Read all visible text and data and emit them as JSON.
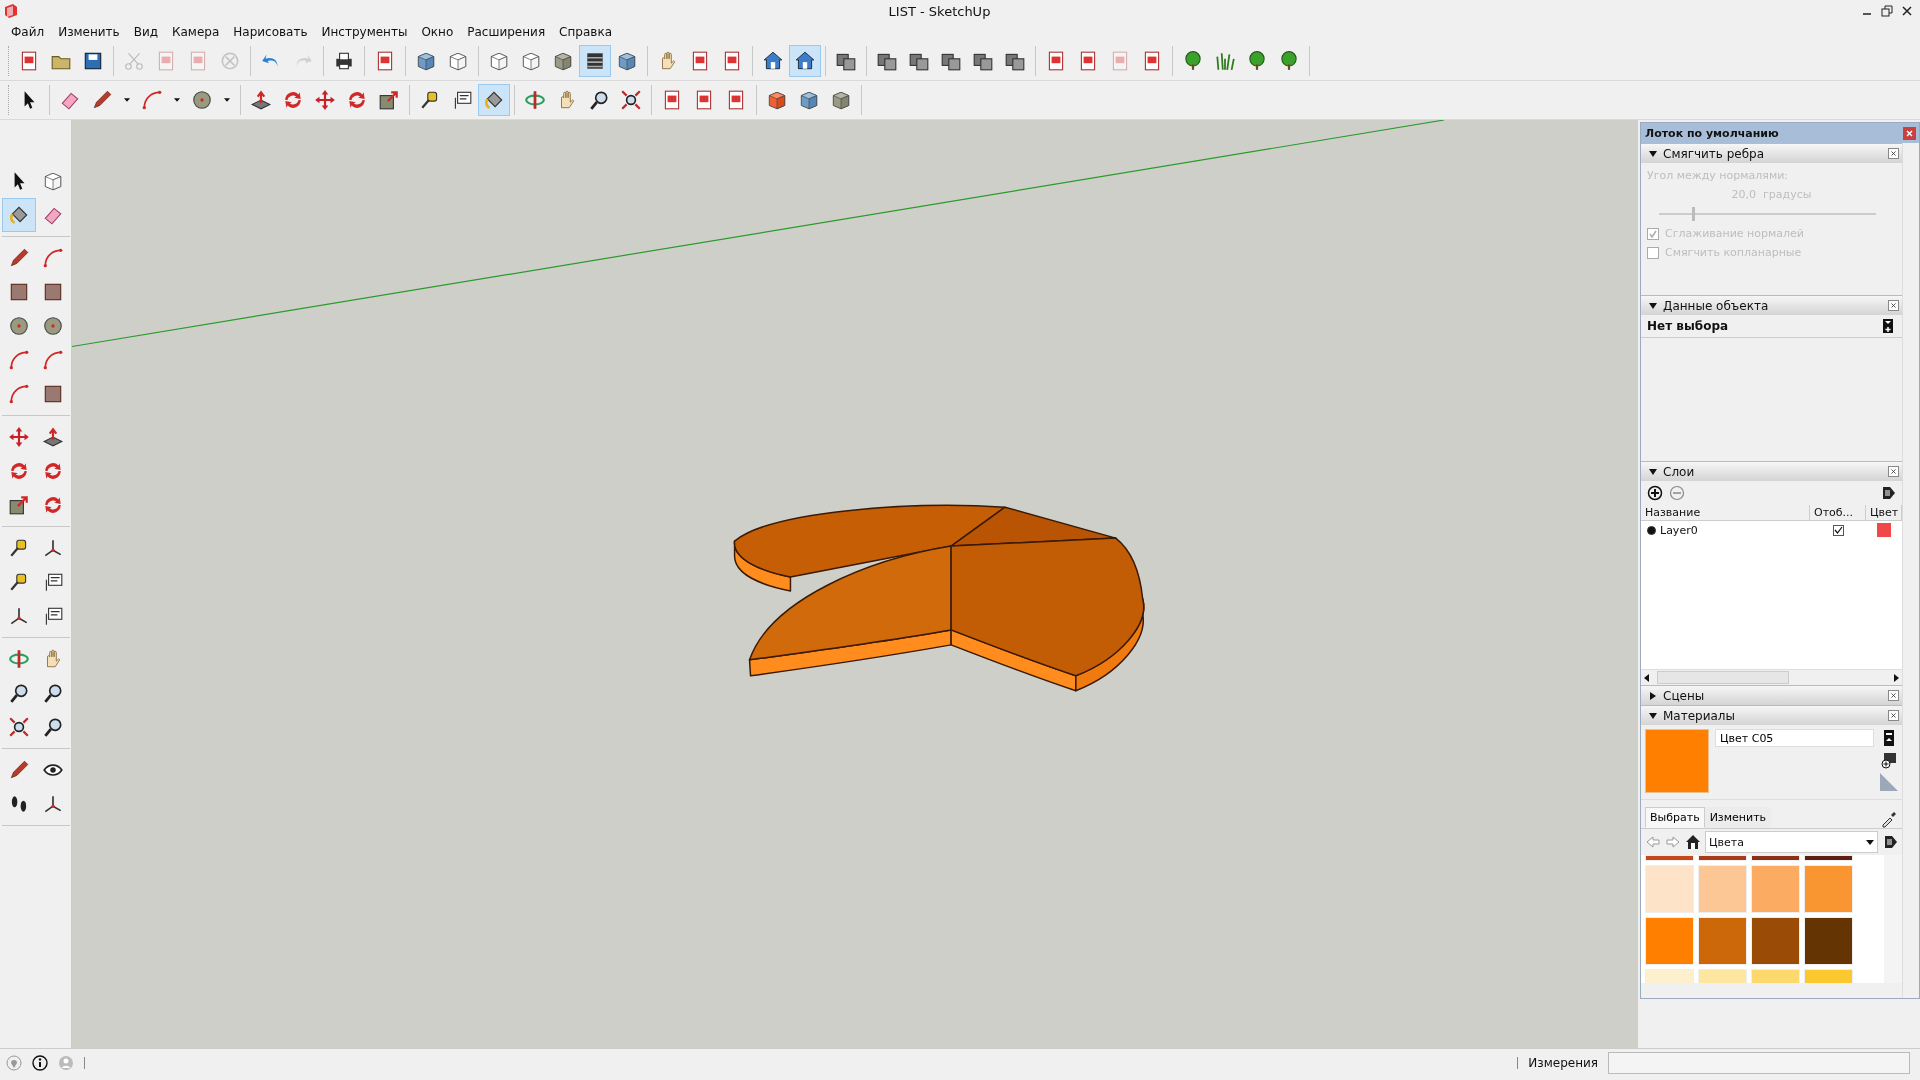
{
  "window": {
    "title": "LIST - SketchUp"
  },
  "menu": [
    "Файл",
    "Изменить",
    "Вид",
    "Камера",
    "Нарисовать",
    "Инструменты",
    "Окно",
    "Расширения",
    "Справка"
  ],
  "toolbar_rows": [
    {
      "groups": [
        {
          "buttons": [
            {
              "kind": "doc",
              "selected": false,
              "disabled": false
            },
            {
              "kind": "folder",
              "selected": false,
              "disabled": false
            },
            {
              "kind": "disk",
              "selected": false,
              "disabled": false
            }
          ]
        },
        {
          "buttons": [
            {
              "kind": "scissors",
              "selected": false,
              "disabled": true
            },
            {
              "kind": "doc",
              "selected": false,
              "disabled": true
            },
            {
              "kind": "doc",
              "selected": false,
              "disabled": true
            },
            {
              "kind": "cross",
              "selected": false,
              "disabled": true
            }
          ]
        },
        {
          "buttons": [
            {
              "kind": "undo",
              "selected": false,
              "disabled": false
            },
            {
              "kind": "redo",
              "selected": false,
              "disabled": true
            }
          ]
        },
        {
          "buttons": [
            {
              "kind": "printer",
              "selected": false,
              "disabled": false
            }
          ]
        },
        {
          "buttons": [
            {
              "kind": "doc",
              "selected": false,
              "disabled": false
            }
          ]
        },
        {
          "buttons": [
            {
              "kind": "cube-blue",
              "selected": false,
              "disabled": false
            },
            {
              "kind": "cube-outline",
              "selected": false,
              "disabled": false
            }
          ]
        },
        {
          "buttons": [
            {
              "kind": "cube-outline",
              "selected": false,
              "disabled": false
            },
            {
              "kind": "cube-outline",
              "selected": false,
              "disabled": false
            },
            {
              "kind": "cube-grey",
              "selected": false,
              "disabled": false
            },
            {
              "kind": "stack",
              "selected": true,
              "disabled": false
            },
            {
              "kind": "cube-blue",
              "selected": false,
              "disabled": false
            }
          ]
        },
        {
          "buttons": [
            {
              "kind": "hand",
              "selected": false,
              "disabled": false
            },
            {
              "kind": "doc",
              "selected": false,
              "disabled": false
            },
            {
              "kind": "doc",
              "selected": false,
              "disabled": false
            }
          ]
        },
        {
          "buttons": [
            {
              "kind": "house",
              "selected": false,
              "disabled": false
            },
            {
              "kind": "house",
              "selected": true,
              "disabled": false
            }
          ]
        },
        {
          "buttons": [
            {
              "kind": "boxes",
              "selected": false,
              "disabled": false
            }
          ]
        },
        {
          "buttons": [
            {
              "kind": "boxes",
              "selected": false,
              "disabled": false
            },
            {
              "kind": "boxes",
              "selected": false,
              "disabled": false
            },
            {
              "kind": "boxes",
              "selected": false,
              "disabled": false
            },
            {
              "kind": "boxes",
              "selected": false,
              "disabled": false
            },
            {
              "kind": "boxes",
              "selected": false,
              "disabled": false
            }
          ]
        },
        {
          "buttons": [
            {
              "kind": "doc",
              "selected": false,
              "disabled": false
            },
            {
              "kind": "doc",
              "selected": false,
              "disabled": false
            },
            {
              "kind": "doc",
              "selected": false,
              "disabled": true
            },
            {
              "kind": "doc",
              "selected": false,
              "disabled": false
            }
          ]
        },
        {
          "buttons": [
            {
              "kind": "tree",
              "selected": false,
              "disabled": false
            },
            {
              "kind": "grass",
              "selected": false,
              "disabled": false
            },
            {
              "kind": "tree",
              "selected": false,
              "disabled": false
            },
            {
              "kind": "tree",
              "selected": false,
              "disabled": false
            }
          ]
        }
      ]
    },
    {
      "groups": [
        {
          "buttons": [
            {
              "kind": "arrow",
              "selected": false,
              "disabled": false
            }
          ]
        },
        {
          "buttons": [
            {
              "kind": "eraser",
              "selected": false,
              "disabled": false
            },
            {
              "kind": "pencil",
              "selected": false,
              "disabled": false
            },
            {
              "kind": "caret",
              "selected": false,
              "disabled": false
            },
            {
              "kind": "arc",
              "selected": false,
              "disabled": false
            },
            {
              "kind": "caret",
              "selected": false,
              "disabled": false
            },
            {
              "kind": "circle",
              "selected": false,
              "disabled": false
            },
            {
              "kind": "caret",
              "selected": false,
              "disabled": false
            }
          ]
        },
        {
          "buttons": [
            {
              "kind": "pushpull",
              "selected": false,
              "disabled": false
            },
            {
              "kind": "rotate",
              "selected": false,
              "disabled": false
            },
            {
              "kind": "move",
              "selected": false,
              "disabled": false
            },
            {
              "kind": "rotate",
              "selected": false,
              "disabled": false
            },
            {
              "kind": "scale",
              "selected": false,
              "disabled": false
            }
          ]
        },
        {
          "buttons": [
            {
              "kind": "tape",
              "selected": false,
              "disabled": false
            },
            {
              "kind": "text",
              "selected": false,
              "disabled": false
            },
            {
              "kind": "paint",
              "selected": true,
              "disabled": false
            }
          ]
        },
        {
          "buttons": [
            {
              "kind": "orbit",
              "selected": false,
              "disabled": false
            },
            {
              "kind": "hand",
              "selected": false,
              "disabled": false
            },
            {
              "kind": "zoom",
              "selected": false,
              "disabled": false
            },
            {
              "kind": "zoom-extents",
              "selected": false,
              "disabled": false
            }
          ]
        },
        {
          "buttons": [
            {
              "kind": "doc",
              "selected": false,
              "disabled": false
            },
            {
              "kind": "doc",
              "selected": false,
              "disabled": false
            },
            {
              "kind": "doc",
              "selected": false,
              "disabled": false
            }
          ]
        },
        {
          "buttons": [
            {
              "kind": "cube-red",
              "selected": false,
              "disabled": false
            },
            {
              "kind": "cube-blue",
              "selected": false,
              "disabled": false
            },
            {
              "kind": "cube-grey",
              "selected": false,
              "disabled": false
            }
          ]
        }
      ]
    }
  ],
  "left_toolbar": {
    "groups": [
      {
        "buttons": [
          {
            "kind": "arrow",
            "selected": false,
            "disabled": false
          },
          {
            "kind": "cube-outline",
            "selected": false,
            "disabled": false
          },
          {
            "kind": "paint",
            "selected": true,
            "disabled": false
          },
          {
            "kind": "eraser",
            "selected": false,
            "disabled": false
          }
        ]
      },
      {
        "buttons": [
          {
            "kind": "pencil",
            "selected": false,
            "disabled": false
          },
          {
            "kind": "arc",
            "selected": false,
            "disabled": false
          },
          {
            "kind": "square",
            "selected": false,
            "disabled": false
          },
          {
            "kind": "square",
            "selected": false,
            "disabled": false
          },
          {
            "kind": "circle",
            "selected": false,
            "disabled": false
          },
          {
            "kind": "circle",
            "selected": false,
            "disabled": false
          },
          {
            "kind": "arc",
            "selected": false,
            "disabled": false
          },
          {
            "kind": "arc",
            "selected": false,
            "disabled": false
          },
          {
            "kind": "arc",
            "selected": false,
            "disabled": false
          },
          {
            "kind": "square",
            "selected": false,
            "disabled": false
          }
        ]
      },
      {
        "buttons": [
          {
            "kind": "move",
            "selected": false,
            "disabled": false
          },
          {
            "kind": "pushpull",
            "selected": false,
            "disabled": false
          },
          {
            "kind": "rotate",
            "selected": false,
            "disabled": false
          },
          {
            "kind": "rotate",
            "selected": false,
            "disabled": false
          },
          {
            "kind": "scale",
            "selected": false,
            "disabled": false
          },
          {
            "kind": "rotate",
            "selected": false,
            "disabled": false
          }
        ]
      },
      {
        "buttons": [
          {
            "kind": "tape",
            "selected": false,
            "disabled": false
          },
          {
            "kind": "axes",
            "selected": false,
            "disabled": false
          },
          {
            "kind": "tape",
            "selected": false,
            "disabled": false
          },
          {
            "kind": "text",
            "selected": false,
            "disabled": false
          },
          {
            "kind": "axes",
            "selected": false,
            "disabled": false
          },
          {
            "kind": "text",
            "selected": false,
            "disabled": false
          }
        ]
      },
      {
        "buttons": [
          {
            "kind": "orbit",
            "selected": false,
            "disabled": false
          },
          {
            "kind": "hand",
            "selected": false,
            "disabled": false
          },
          {
            "kind": "zoom",
            "selected": false,
            "disabled": false
          },
          {
            "kind": "zoom",
            "selected": false,
            "disabled": false
          },
          {
            "kind": "zoom-extents",
            "selected": false,
            "disabled": false
          },
          {
            "kind": "zoom",
            "selected": false,
            "disabled": false
          }
        ]
      },
      {
        "buttons": [
          {
            "kind": "pencil",
            "selected": false,
            "disabled": false
          },
          {
            "kind": "eye",
            "selected": false,
            "disabled": false
          },
          {
            "kind": "footprints",
            "selected": false,
            "disabled": false
          },
          {
            "kind": "axes",
            "selected": false,
            "disabled": false
          }
        ]
      }
    ]
  },
  "tray": {
    "title": "Лоток по умолчанию",
    "panels": [
      {
        "kind": "smooth",
        "title": "Смягчить ребра",
        "expanded": true,
        "disabled": true,
        "angle_label": "Угол между нормалями:",
        "angle_value": "20,0  градусы",
        "level": 0.15,
        "options": [
          {
            "label": "Сглаживание нормалей",
            "checked": true
          },
          {
            "label": "Смягчить копланарные",
            "checked": false
          }
        ]
      },
      {
        "kind": "entity",
        "title": "Данные объекта",
        "expanded": true,
        "selection": "Нет выбора"
      },
      {
        "kind": "layers",
        "title": "Слои",
        "expanded": true,
        "columns": [
          "Название",
          "Отоб...",
          "Цвет"
        ],
        "rows": [
          {
            "name": "Layer0",
            "selected": true,
            "visible": true,
            "color": "#f04848"
          }
        ]
      },
      {
        "kind": "scenes",
        "title": "Сцены",
        "expanded": false
      },
      {
        "kind": "materials",
        "title": "Материалы",
        "expanded": true,
        "current": {
          "name": "Цвет C05",
          "color": "#ff8000"
        },
        "tabs": [
          {
            "label": "Выбрать",
            "selected": true
          },
          {
            "label": "Изменить",
            "selected": false
          }
        ],
        "library": "Цвета",
        "swatches": [
          {
            "color": "#c8461e"
          },
          {
            "color": "#a83c1a"
          },
          {
            "color": "#8a2e16"
          },
          {
            "color": "#5e1e10"
          },
          {
            "color": "#fde3c8"
          },
          {
            "color": "#fcc794"
          },
          {
            "color": "#fbac62"
          },
          {
            "color": "#f99632"
          },
          {
            "color": "#ff8000"
          },
          {
            "color": "#cc680a"
          },
          {
            "color": "#9a4c06"
          },
          {
            "color": "#643402"
          },
          {
            "color": "#fdf0cc"
          },
          {
            "color": "#fde6a0"
          },
          {
            "color": "#fdd86c"
          },
          {
            "color": "#fcc830"
          }
        ]
      }
    ]
  },
  "status_bar": {
    "measurements_label": "Измерения"
  }
}
